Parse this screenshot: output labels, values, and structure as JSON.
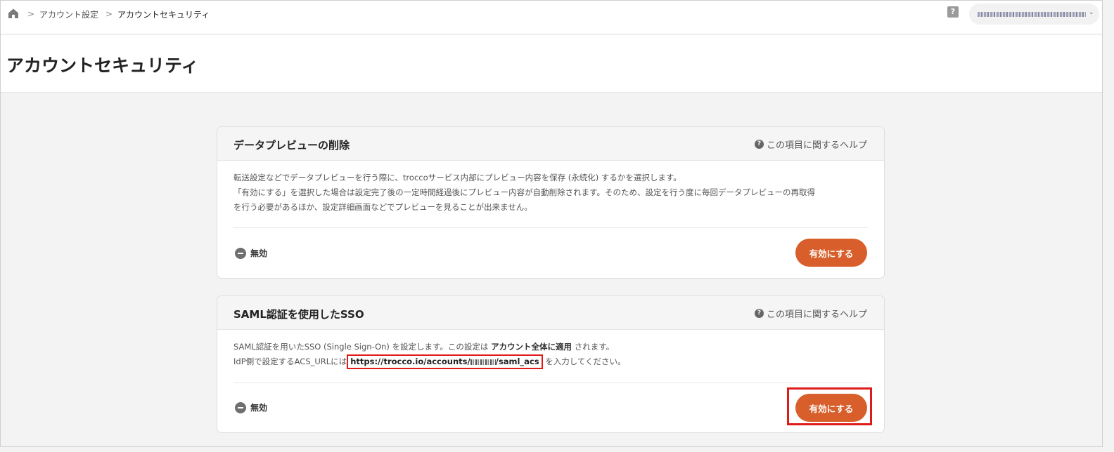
{
  "breadcrumb": {
    "items": [
      "アカウント設定",
      "アカウントセキュリティ"
    ],
    "separator": ">"
  },
  "header": {
    "help_icon": "help-square-icon",
    "user_chevron": "⌄"
  },
  "page": {
    "title": "アカウントセキュリティ"
  },
  "sections": [
    {
      "title": "データプレビューの削除",
      "help_link": "この項目に関するヘルプ",
      "description_lines": [
        "転送設定などでデータプレビューを行う際に、troccoサービス内部にプレビュー内容を保存 (永続化) するかを選択します。",
        "「有効にする」を選択した場合は設定完了後の一定時間経過後にプレビュー内容が自動削除されます。そのため、設定を行う度に毎回データプレビューの再取得",
        "を行う必要があるほか、設定詳細画面などでプレビューを見ることが出来ません。"
      ],
      "status": "無効",
      "button": "有効にする"
    },
    {
      "title": "SAML認証を使用したSSO",
      "help_link": "この項目に関するヘルプ",
      "line1_prefix": "SAML認証を用いたSSO (Single Sign-On) を設定します。この設定は ",
      "line1_bold": "アカウント全体に適用",
      "line1_suffix": " されます。",
      "line2_prefix": "IdP側で設定するACS_URLには",
      "url_prefix": "https://trocco.io/accounts/",
      "url_suffix": "/saml_acs",
      "line2_suffix": " を入力してください。",
      "status": "無効",
      "button": "有効にする"
    }
  ],
  "colors": {
    "accent": "#d85f2b",
    "highlight": "#e01919",
    "background": "#f3f3f3"
  }
}
